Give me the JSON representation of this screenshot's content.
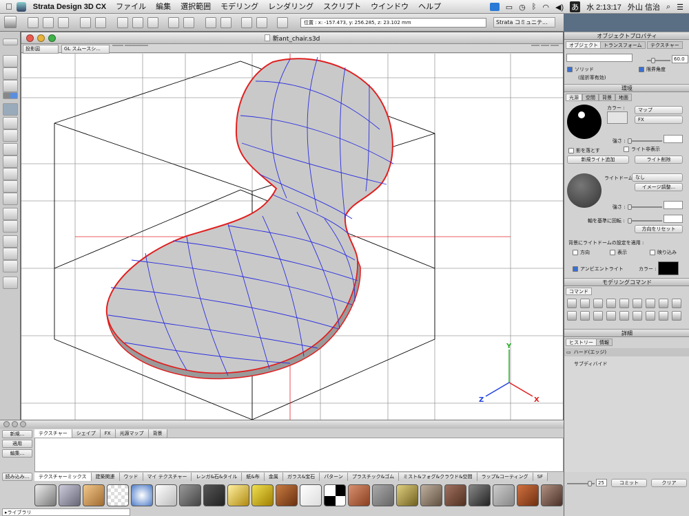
{
  "menubar": {
    "app_name": "Strata Design 3D CX",
    "items": [
      "ファイル",
      "編集",
      "選択範囲",
      "モデリング",
      "レンダリング",
      "スクリプト",
      "ウインドウ",
      "ヘルプ"
    ],
    "clock": "水 2:13:17",
    "user": "外山 信治",
    "ime": "あ"
  },
  "toolbar": {
    "position_readout": "位置 : x: -157.473, y: 256.285, z: 23.102 mm",
    "community_menu": "Strata コミュニテ..."
  },
  "document": {
    "title": "新ant_chair.s3d",
    "view_mode": "投影図",
    "render_mode": "GL スムースシ..."
  },
  "axes": {
    "x": "X",
    "y": "Y",
    "z": "Z"
  },
  "texture_palette": {
    "tabs": [
      "テクスチャー",
      "シェイプ",
      "FX",
      "光源マップ",
      "背景"
    ],
    "buttons": [
      "新規...",
      "適用",
      "編集...",
      "読み込み..."
    ],
    "library_label": "ライブラリ",
    "categories": [
      "テクスチャーミックス",
      "建築関連",
      "ウッド",
      "マイ テクスチャー",
      "レンガ&石&タイル",
      "紙&布",
      "金属",
      "ガラス&宝石",
      "パターン",
      "プラスチック&ゴム",
      "ミスト&フォグ&クラウド&空間",
      "ラップ&コーティング",
      "SF"
    ]
  },
  "object_properties": {
    "title": "オブジェクトプロパティ",
    "tabs": [
      "オブジェクト",
      "トランスフォーム",
      "テクスチャー"
    ],
    "angle_value": "60.0",
    "solid_label": "ソリッド",
    "refraction_note": "(屈折率有効)",
    "limit_angle_label": "限界角度"
  },
  "environment": {
    "title": "環境",
    "tabs": [
      "光源",
      "空間",
      "背景",
      "地面"
    ],
    "color_label": "カラー :",
    "map_select": "マップ",
    "fx_select": "FX",
    "strength_label": "強さ :",
    "cast_shadow": "影を落とす",
    "hide_light": "ライト非表示",
    "new_light_button": "新規ライト追加",
    "delete_light_button": "ライト削除",
    "light_dome_label": "ライトドーム :",
    "light_dome_value": "なし",
    "image_adjust_button": "イメージ調整...",
    "strength2_label": "強さ :",
    "rotate_axis_label": "軸を基準に回転 :",
    "reset_direction_button": "方向をリセット",
    "apply_dome_label": "背景にライトドームの設定を適用 :",
    "direction_label": "方向",
    "display_label": "表示",
    "reflect_label": "映り込み",
    "ambient_label": "アンビエントライト",
    "ambient_color_label": "カラー :"
  },
  "modeling_commands": {
    "title": "モデリングコマンド",
    "tab": "コマンド"
  },
  "details": {
    "title": "詳細",
    "tabs": [
      "ヒストリー",
      "情報"
    ],
    "items": [
      "ハード(エッジ)",
      "サブディバイド"
    ],
    "level": "25",
    "commit_button": "コミット",
    "clear_button": "クリア"
  },
  "colors": {
    "mesh_wire": "#2a2de0",
    "mesh_edge": "#d42020",
    "axis_red": "#e02020",
    "axis_green": "#20b020",
    "axis_blue": "#2040e0",
    "desktop": "#5a6e84"
  }
}
